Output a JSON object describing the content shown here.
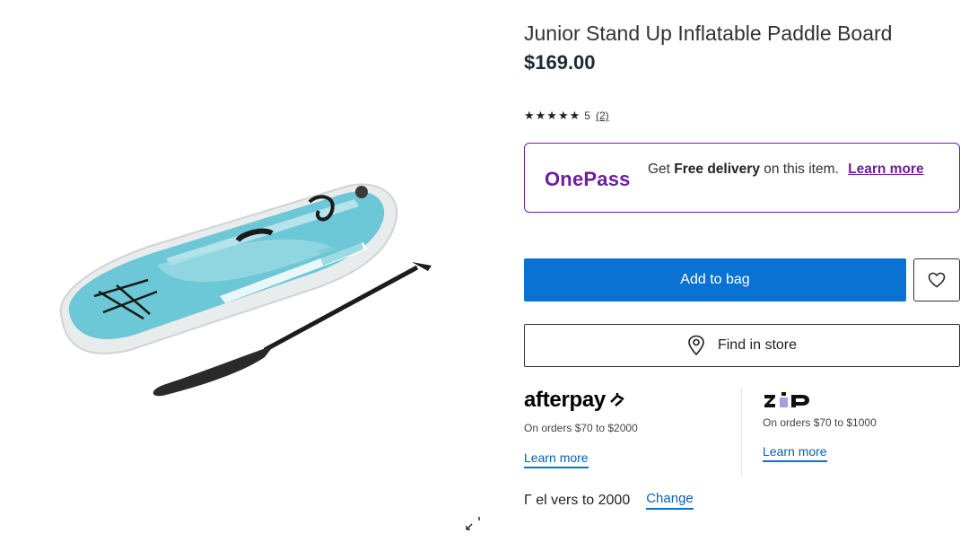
{
  "product": {
    "title": "Junior Stand Up Inflatable Paddle Board",
    "price": "$169.00",
    "image_icon": "paddle-board-image"
  },
  "rating": {
    "stars": "★★★★★",
    "value": "5",
    "count": "(2)"
  },
  "onepass": {
    "logo": "OnePass",
    "text_prefix": "Get ",
    "text_bold": "Free delivery",
    "text_suffix": " on this item.",
    "link": "Learn more",
    "color": "#6b1f9e"
  },
  "actions": {
    "add_to_bag": "Add to bag",
    "wishlist_icon": "heart-icon",
    "find_in_store": "Find in store",
    "accent": "#0a72d2"
  },
  "afterpay": {
    "logo": "afterpay",
    "subtitle": "On orders $70 to $2000",
    "learn_more": "Learn more"
  },
  "zip": {
    "logo": "zip",
    "subtitle": "On orders $70 to $1000",
    "learn_more": "Learn more"
  },
  "delivery": {
    "text": "Γ el  vers to 2000",
    "change": "Change"
  }
}
